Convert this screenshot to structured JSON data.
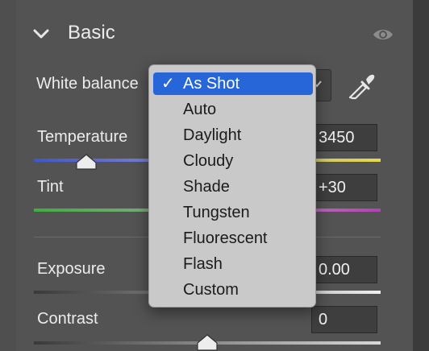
{
  "section": {
    "title": "Basic",
    "expanded_icon": "chevron-down-icon",
    "visibility_icon": "eye-icon"
  },
  "white_balance": {
    "label": "White balance",
    "eyedropper_icon": "eyedropper-icon",
    "selected": "As Shot",
    "options": [
      "As Shot",
      "Auto",
      "Daylight",
      "Cloudy",
      "Shade",
      "Tungsten",
      "Fluorescent",
      "Flash",
      "Custom"
    ],
    "check_glyph": "✓"
  },
  "sliders": {
    "temperature": {
      "label": "Temperature",
      "value": "3450"
    },
    "tint": {
      "label": "Tint",
      "value": "+30"
    },
    "exposure": {
      "label": "Exposure",
      "value": "0.00"
    },
    "contrast": {
      "label": "Contrast",
      "value": "0"
    }
  },
  "colors": {
    "panel": "#535353",
    "menu": "#c9c9c9",
    "menu_highlight": "#2766d8"
  }
}
